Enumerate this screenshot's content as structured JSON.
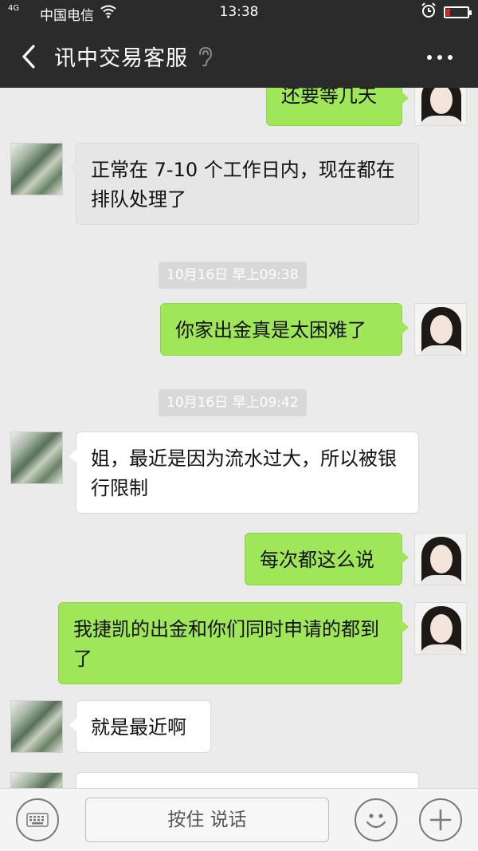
{
  "status_bar": {
    "signal": "4G",
    "carrier": "中国电信",
    "time": "13:38",
    "battery_level_percent": 20,
    "battery_color": "#e02020"
  },
  "header": {
    "back_icon": "chevron-left-icon",
    "title": "讯中交易客服",
    "earpiece_icon": "ear-icon",
    "more_icon": "more-horizontal-icon"
  },
  "messages": [
    {
      "side": "sent",
      "text": "还要等几天"
    },
    {
      "side": "received",
      "text": "正常在 7-10 个工作日内，现在都在排队处理了"
    },
    {
      "type": "timestamp",
      "text": "10月16日 早上09:38"
    },
    {
      "side": "sent",
      "text": "你家出金真是太困难了"
    },
    {
      "type": "timestamp",
      "text": "10月16日 早上09:42"
    },
    {
      "side": "received",
      "text": "姐，最近是因为流水过大，所以被银行限制"
    },
    {
      "side": "sent",
      "text": "每次都这么说"
    },
    {
      "side": "sent",
      "text": "我捷凯的出金和你们同时申请的都到了"
    },
    {
      "side": "received",
      "text": "就是最近啊"
    }
  ],
  "input_bar": {
    "keyboard_icon": "keyboard-icon",
    "hold_to_talk_label": "按住 说话",
    "emoji_icon": "smiley-icon",
    "plus_icon": "plus-icon"
  },
  "colors": {
    "header_bg": "#2b2b2b",
    "chat_bg": "#ebebeb",
    "sent_bubble": "#9fe658",
    "received_bubble": "#ffffff"
  }
}
